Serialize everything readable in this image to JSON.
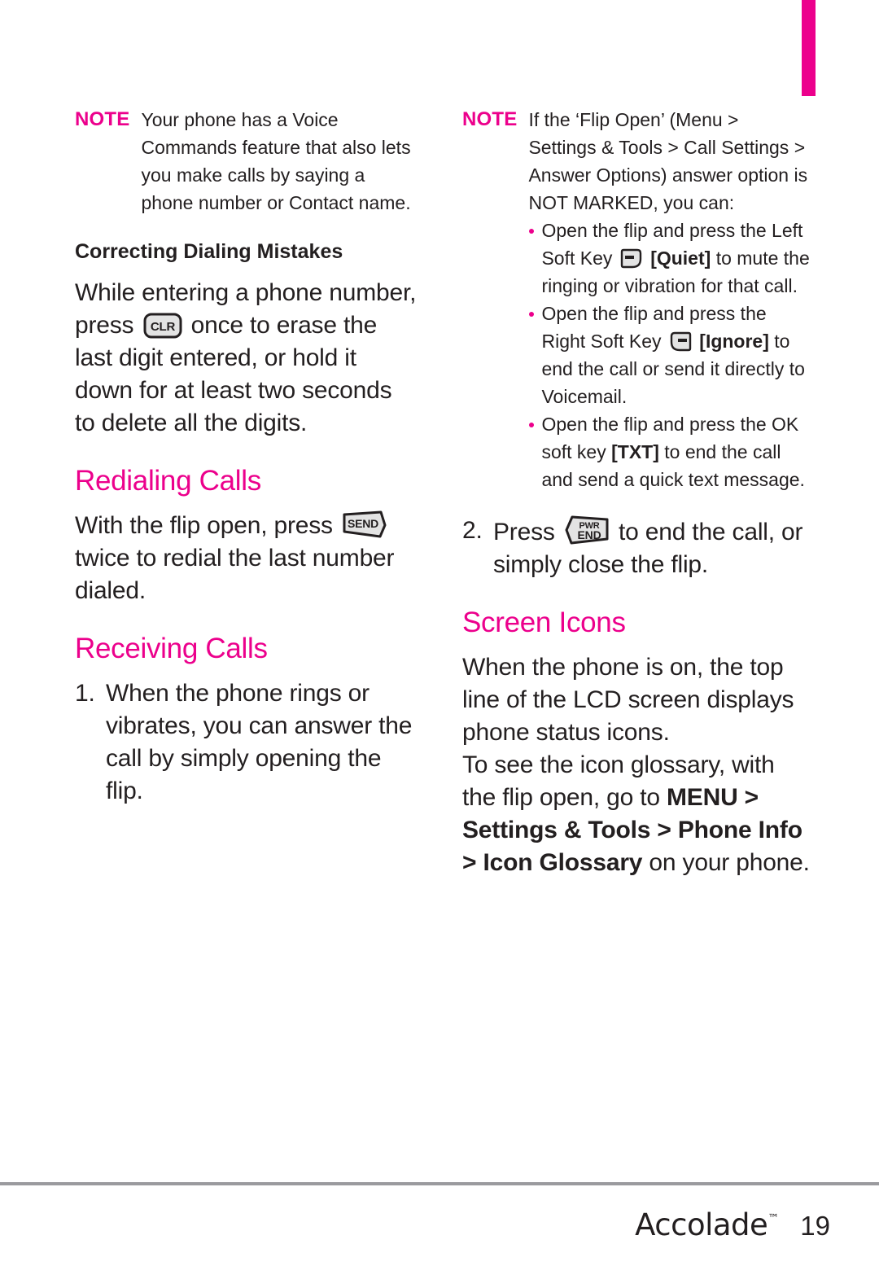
{
  "page": {
    "number": "19",
    "brand": "Accolade",
    "trademark": "™",
    "tab_color": "#ec008c",
    "heading_color": "#ec008c",
    "text_color": "#231f20"
  },
  "left_column": {
    "note": {
      "label": "NOTE",
      "text": "Your phone has a Voice Commands feature that also lets you make calls by saying a phone number or Contact name."
    },
    "subheading": "Correcting Dialing Mistakes",
    "paragraph_1_part_1": "While entering a phone number, press",
    "clr_key_label": "CLR",
    "paragraph_1_part_2": "once to erase the last digit entered, or hold it down for at least two seconds to delete all the digits.",
    "heading_redialing": "Redialing Calls",
    "paragraph_2_part_1": "With the flip open, press",
    "send_key_label": "SEND",
    "paragraph_2_part_2": "twice to redial the last number dialed.",
    "heading_receiving": "Receiving Calls",
    "steps": [
      {
        "number": "1.",
        "text": "When the phone rings or vibrates, you can answer the call by simply opening the flip."
      }
    ]
  },
  "right_column": {
    "note": {
      "label": "NOTE",
      "intro": "If the ‘Flip Open’ (Menu > Settings & Tools > Call Settings > Answer Options) answer option is NOT MARKED, you can:",
      "bullets": [
        {
          "part_1": "Open the flip and press the Left Soft Key",
          "icon": "left-soft-key-icon",
          "part_2": "[Quiet]",
          "part_3": "to mute the ringing or vibration for that call."
        },
        {
          "part_1": "Open the flip and press the Right Soft Key",
          "icon": "right-soft-key-icon",
          "part_2": "[Ignore]",
          "part_3": "to end the call or send it directly to Voicemail."
        },
        {
          "part_1": "Open the flip and press the OK soft key",
          "icon": "",
          "part_2": "[TXT]",
          "part_3": "to end the call and send a quick text message."
        }
      ]
    },
    "step_2": {
      "number": "2.",
      "part_1": "Press",
      "pwr_end_key_line1": "PWR",
      "pwr_end_key_line2": "END",
      "part_2": "to end the call, or simply close the flip."
    },
    "heading_screen_icons": "Screen Icons",
    "paragraph_1": "When the phone is on, the top line of the LCD screen displays phone status icons.",
    "paragraph_2_part_1": "To see the icon glossary, with the flip open, go to ",
    "paragraph_2_bold_1": "MENU",
    "paragraph_2_sep_1": " > ",
    "paragraph_2_bold_2": "Settings & Tools ",
    "paragraph_2_sep_2": " > ",
    "paragraph_2_bold_3": "Phone Info",
    "paragraph_2_sep_3": " > ",
    "paragraph_2_bold_4": "Icon Glossary",
    "paragraph_2_part_2": " on your phone."
  }
}
